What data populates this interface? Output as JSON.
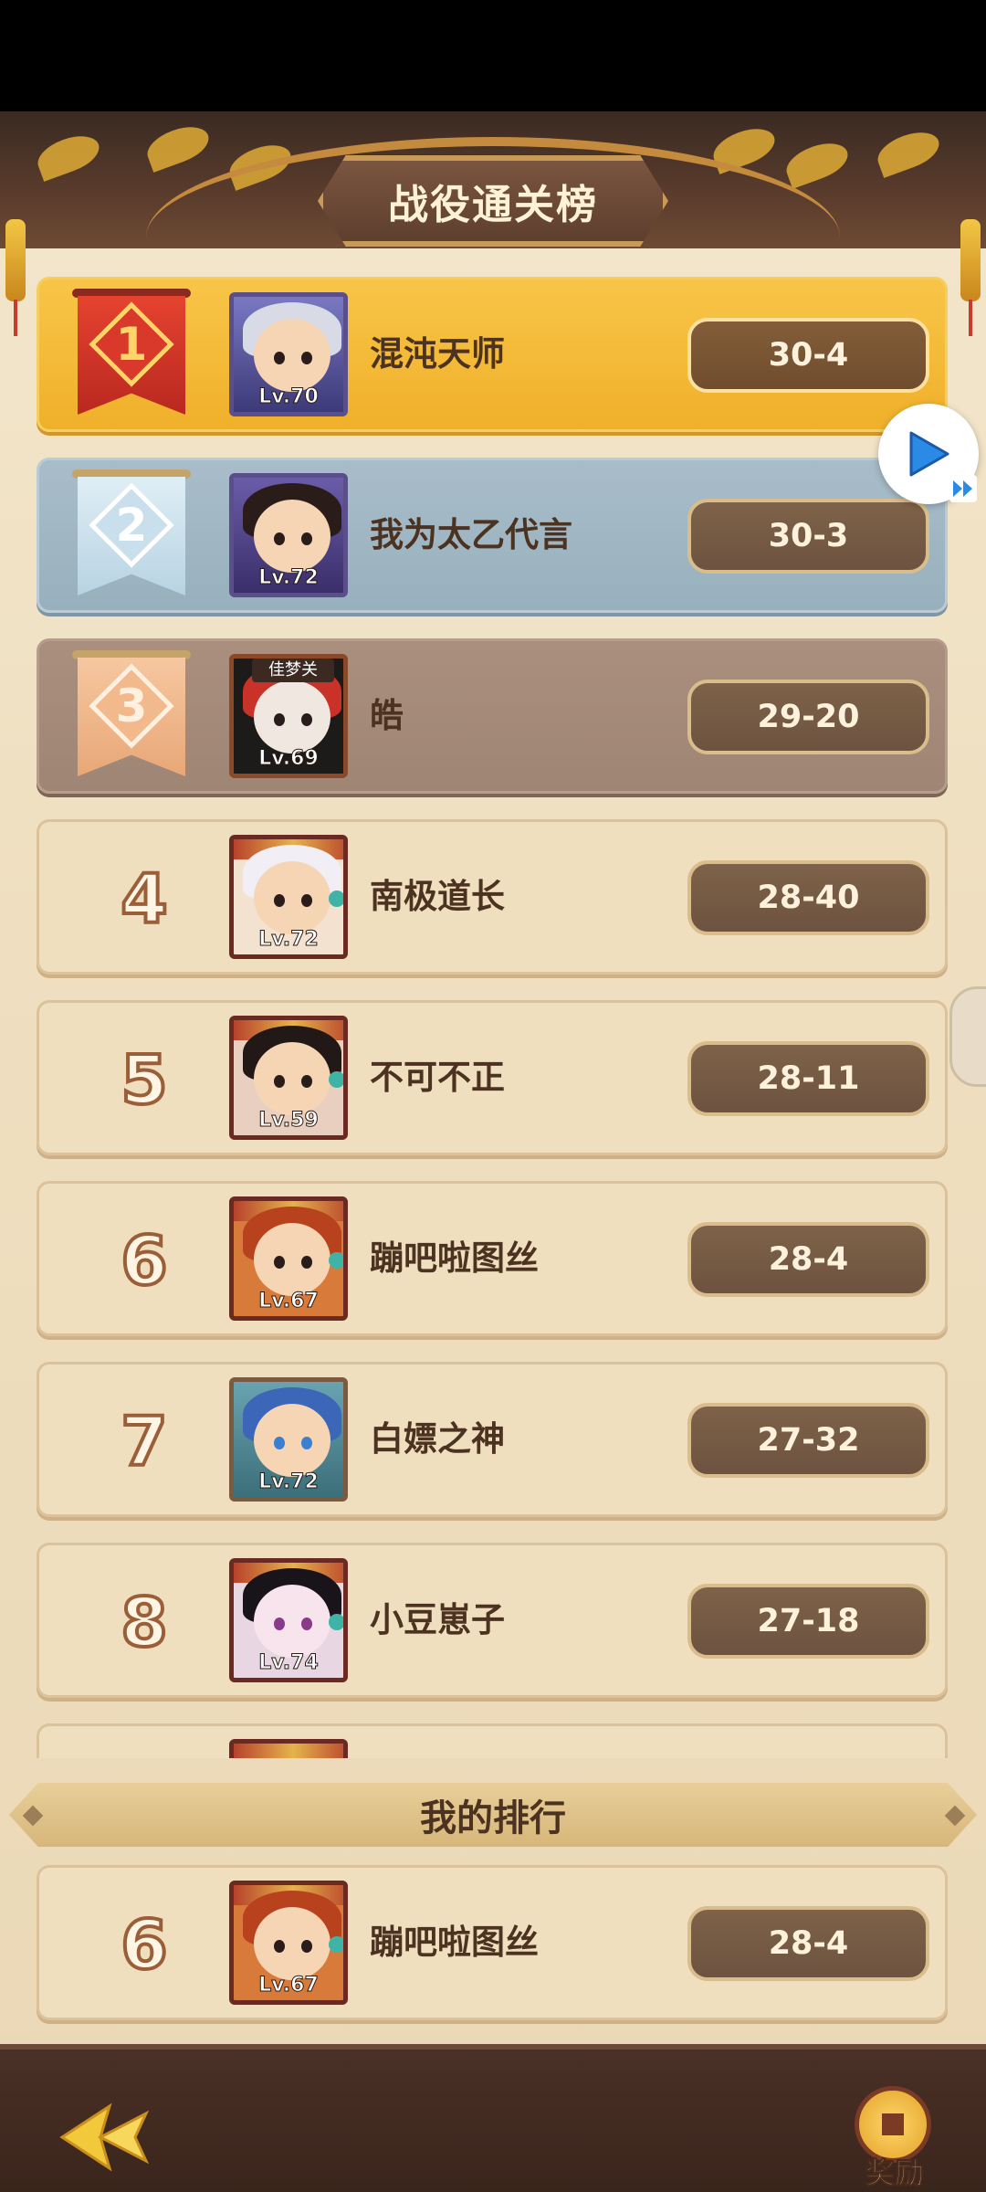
{
  "header": {
    "title": "战役通关榜"
  },
  "ranking": [
    {
      "rank": "1",
      "badge": "gold",
      "name": "混沌天师",
      "level": "Lv.70",
      "score": "30-4",
      "avatar": "silver-hair-tianshi"
    },
    {
      "rank": "2",
      "badge": "silver",
      "name": "我为太乙代言",
      "level": "Lv.72",
      "score": "30-3",
      "avatar": "dark-hair-sage"
    },
    {
      "rank": "3",
      "badge": "bronze",
      "name": "皓",
      "level": "Lv.69",
      "score": "29-20",
      "avatar": "masked-warrior",
      "tag": "佳梦关"
    },
    {
      "rank": "4",
      "badge": "plain",
      "name": "南极道长",
      "level": "Lv.72",
      "score": "28-40",
      "avatar": "white-hair-girl"
    },
    {
      "rank": "5",
      "badge": "plain",
      "name": "不可不正",
      "level": "Lv.59",
      "score": "28-11",
      "avatar": "dark-hair-boy"
    },
    {
      "rank": "6",
      "badge": "plain",
      "name": "蹦吧啦图丝",
      "level": "Lv.67",
      "score": "28-4",
      "avatar": "lion-warrior"
    },
    {
      "rank": "7",
      "badge": "plain",
      "name": "白嫖之神",
      "level": "Lv.72",
      "score": "27-32",
      "avatar": "blue-hair-girl"
    },
    {
      "rank": "8",
      "badge": "plain",
      "name": "小豆崽子",
      "level": "Lv.74",
      "score": "27-18",
      "avatar": "black-hair-lady"
    }
  ],
  "my_rank": {
    "label": "我的排行",
    "rank": "6",
    "name": "蹦吧啦图丝",
    "level": "Lv.67",
    "score": "28-4"
  },
  "footer": {
    "reward_label": "奖励"
  },
  "icons": {
    "back": "back-arrow-icon",
    "reward": "coin-reward-icon",
    "play": "play-icon"
  },
  "colors": {
    "gold_row": "#f0b02a",
    "silver_row": "#98b0bd",
    "bronze_row": "#9f8574",
    "plain_row": "#f0dfbf",
    "score_pill": "#6d5340"
  }
}
